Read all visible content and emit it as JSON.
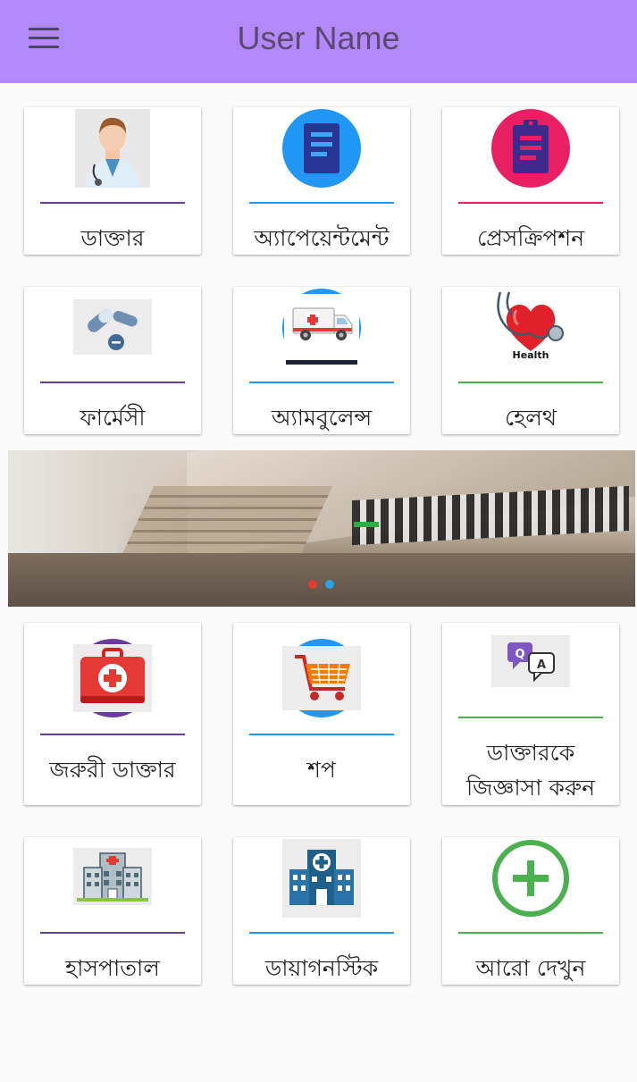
{
  "app_bar": {
    "title": "User Name",
    "menu_icon": "hamburger-menu-icon",
    "background": "#b388fb"
  },
  "menu_row_1": [
    {
      "label": "ডাক্তার",
      "icon": "doctor-icon",
      "accent": "#6a3d9a"
    },
    {
      "label": "অ্যাপেয়েন্টমেন্ট",
      "icon": "appointment-icon",
      "accent": "#2196f3"
    },
    {
      "label": "প্রেসক্রিপশন",
      "icon": "prescription-icon",
      "accent": "#e91e63"
    }
  ],
  "menu_row_2": [
    {
      "label": "ফার্মেসী",
      "icon": "pills-icon",
      "accent": "#6a3d9a"
    },
    {
      "label": "অ্যামবুলেন্স",
      "icon": "ambulance-icon",
      "accent": "#2196f3"
    },
    {
      "label": "হেলথ",
      "icon": "health-heart-icon",
      "icon_caption": "Health",
      "accent": "#4caf50"
    }
  ],
  "banner": {
    "active_dot_color": "#e53935",
    "inactive_dot_color": "#29a3e0"
  },
  "menu_row_3": [
    {
      "label": "জরুরী ডাক্তার",
      "icon": "first-aid-kit-icon",
      "accent": "#6a3d9a"
    },
    {
      "label": "শপ",
      "icon": "shopping-cart-icon",
      "accent": "#2196f3"
    },
    {
      "label_line1": "ডাক্তারকে",
      "label_line2": "জিজ্ঞাসা করুন",
      "icon": "question-answer-icon",
      "accent": "#4caf50"
    }
  ],
  "menu_row_4": [
    {
      "label": "হাসপাতাল",
      "icon": "hospital-building-icon",
      "accent": "#6a3d9a"
    },
    {
      "label": "ডায়াগনস্টিক",
      "icon": "diagnostic-center-icon",
      "accent": "#2196f3"
    },
    {
      "label": "আরো দেখুন",
      "icon": "add-circle-icon",
      "accent": "#4caf50"
    }
  ]
}
